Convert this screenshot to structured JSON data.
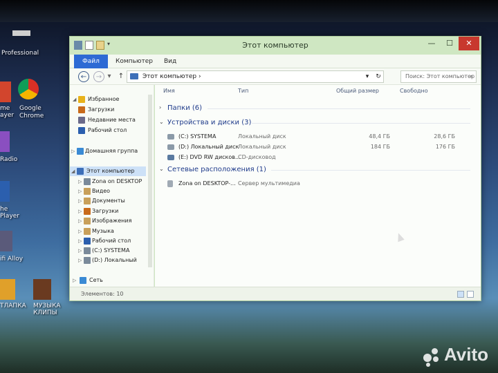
{
  "desktop": {
    "icons": [
      {
        "label": "Professional",
        "color": "#cfcfcf"
      },
      {
        "label": "me\nayer",
        "color": "#d2452d"
      },
      {
        "label": "Google Chrome",
        "color": "#e8a316"
      },
      {
        "label": "Radio",
        "color": "#8a4fc0"
      },
      {
        "label": "he\nPlayer",
        "color": "#2b5fae"
      },
      {
        "label": "ifi Alloy",
        "color": "#5a5a7a"
      },
      {
        "label": "ТЛАПКА",
        "color": "#e0a02a"
      },
      {
        "label": "МУЗЫКА КЛИПЫ",
        "color": "#6a3a20"
      }
    ]
  },
  "window": {
    "title": "Этот компьютер",
    "controls": {
      "minimize": "—",
      "maximize": "☐",
      "close": "✕"
    }
  },
  "ribbon": {
    "tabs": [
      "Файл",
      "Компьютер",
      "Вид"
    ]
  },
  "navbar": {
    "back": "←",
    "forward": "→",
    "history": "▾",
    "up": "↑",
    "address": "Этот компьютер",
    "address_sep": "›",
    "search_placeholder": "Поиск: Этот компьютер",
    "search_icon": "⌕",
    "refresh": "↻",
    "drop": "▾"
  },
  "navpane": {
    "items": [
      {
        "label": "Избранное",
        "icon": "star-icon",
        "color": "#e8b21a",
        "tri": "◢"
      },
      {
        "label": "Загрузки",
        "icon": "downloads-icon",
        "color": "#c86a1a",
        "tri": ""
      },
      {
        "label": "Недавние места",
        "icon": "recent-icon",
        "color": "#6a6a8a",
        "tri": ""
      },
      {
        "label": "Рабочий стол",
        "icon": "desktop-icon",
        "color": "#2b5fae",
        "tri": ""
      },
      {
        "label": "Домашняя группа",
        "icon": "homegroup-icon",
        "color": "#3a8ad4",
        "tri": "▷"
      },
      {
        "label": "Этот компьютер",
        "icon": "computer-icon",
        "color": "#3d6fb8",
        "tri": "◢"
      },
      {
        "label": "Zona on DESKTOP",
        "icon": "network-folder-icon",
        "color": "#7a8a9a",
        "tri": "▷"
      },
      {
        "label": "Видео",
        "icon": "video-icon",
        "color": "#c8a05a",
        "tri": "▷"
      },
      {
        "label": "Документы",
        "icon": "documents-icon",
        "color": "#c8a05a",
        "tri": "▷"
      },
      {
        "label": "Загрузки",
        "icon": "downloads-icon",
        "color": "#c86a1a",
        "tri": "▷"
      },
      {
        "label": "Изображения",
        "icon": "pictures-icon",
        "color": "#c8a05a",
        "tri": "▷"
      },
      {
        "label": "Музыка",
        "icon": "music-icon",
        "color": "#c8a05a",
        "tri": "▷"
      },
      {
        "label": "Рабочий стол",
        "icon": "desktop-icon",
        "color": "#2b5fae",
        "tri": "▷"
      },
      {
        "label": "(C:) SYSTEMA",
        "icon": "drive-icon",
        "color": "#7a8a9a",
        "tri": "▷"
      },
      {
        "label": "(D:) Локальный",
        "icon": "drive-icon",
        "color": "#7a8a9a",
        "tri": "▷"
      },
      {
        "label": "Сеть",
        "icon": "network-icon",
        "color": "#3a8ad4",
        "tri": "▷"
      }
    ]
  },
  "content": {
    "columns": [
      "Имя",
      "Тип",
      "Общий размер",
      "Свободно"
    ],
    "groups": [
      {
        "title": "Папки (6)",
        "arrow": "›",
        "rows": []
      },
      {
        "title": "Устройства и диски (3)",
        "arrow": "⌄",
        "rows": [
          {
            "name": "(C:) SYSTEMA",
            "type": "Локальный диск",
            "size": "48,4 ГБ",
            "free": "28,6 ГБ"
          },
          {
            "name": "(D:) Локальный диск",
            "type": "Локальный диск",
            "size": "184 ГБ",
            "free": "176 ГБ"
          },
          {
            "name": "(E:) DVD RW дисков...",
            "type": "CD-дисковод",
            "size": "",
            "free": ""
          }
        ]
      },
      {
        "title": "Сетевые расположения (1)",
        "arrow": "⌄",
        "rows": [
          {
            "name": "Zona on DESKTOP-...",
            "type": "Сервер мультимедиа",
            "size": "",
            "free": ""
          }
        ]
      }
    ]
  },
  "statusbar": {
    "text": "Элементов: 10"
  },
  "watermark": {
    "text": "Avito"
  }
}
